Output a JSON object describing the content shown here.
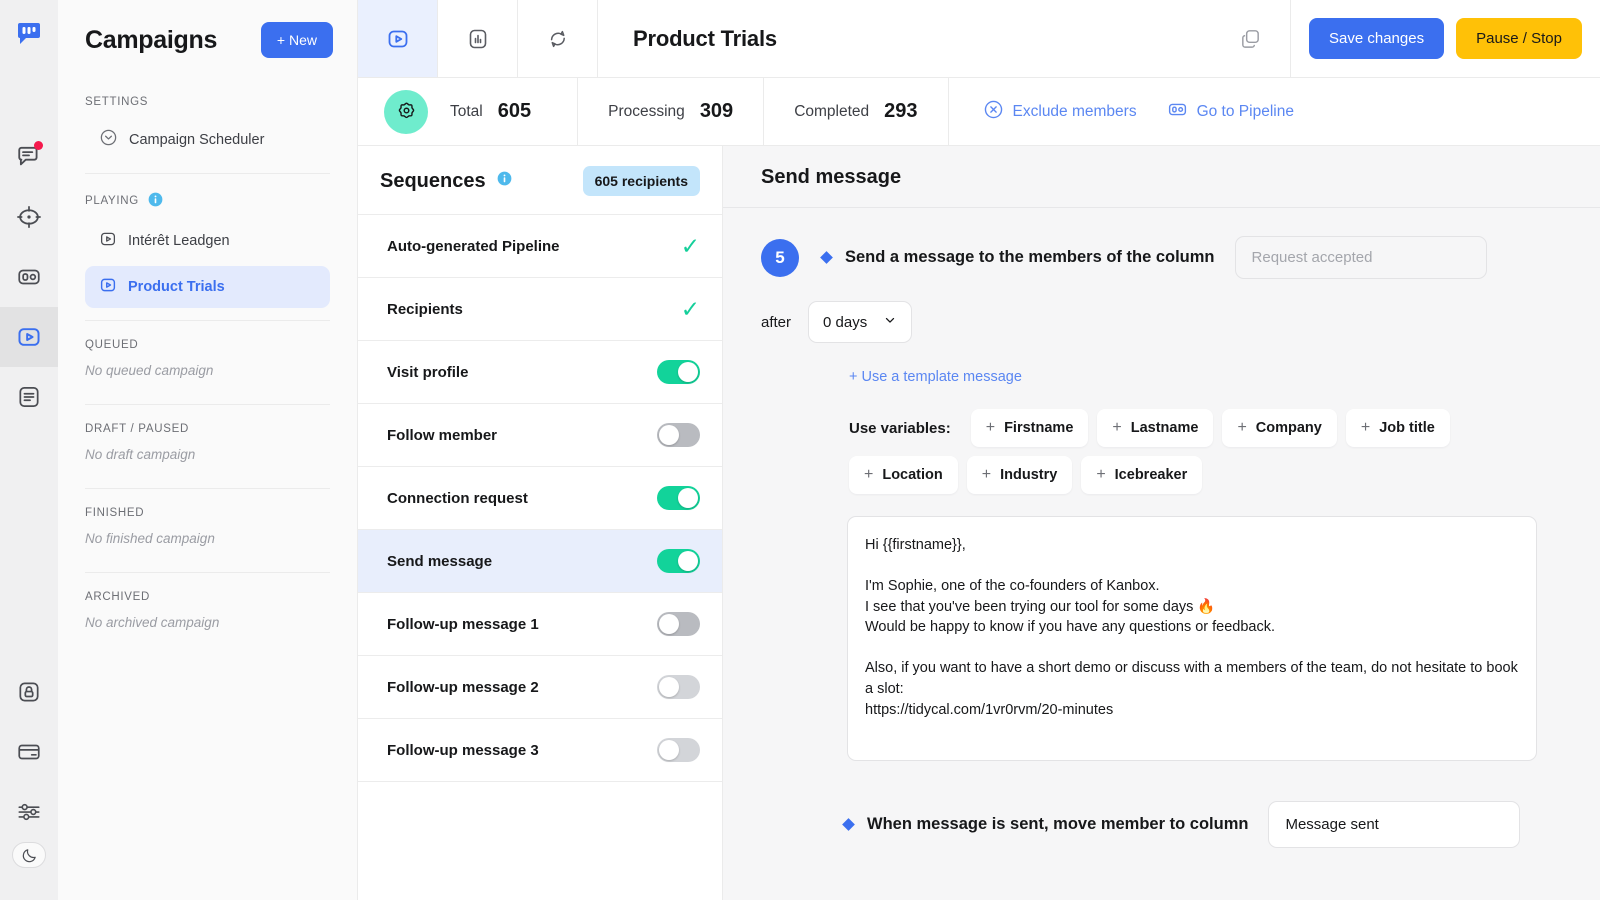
{
  "rail": {
    "logo": "kanbox-logo",
    "items": [
      {
        "name": "inbox-icon",
        "badge": true
      },
      {
        "name": "target-icon",
        "badge": false
      },
      {
        "name": "pipeline-icon",
        "badge": false
      },
      {
        "name": "campaigns-icon",
        "badge": false,
        "active": true
      },
      {
        "name": "templates-icon",
        "badge": false
      }
    ],
    "bottom_items": [
      {
        "name": "lock-icon"
      },
      {
        "name": "billing-card-icon"
      },
      {
        "name": "settings-sliders-icon"
      }
    ],
    "theme_toggle": "moon-icon"
  },
  "sidebar": {
    "title": "Campaigns",
    "new_button": "+ New",
    "settings_label": "SETTINGS",
    "scheduler_item": "Campaign Scheduler",
    "playing_label": "PLAYING",
    "playing_items": [
      {
        "label": "Intérêt Leadgen",
        "selected": false
      },
      {
        "label": "Product Trials",
        "selected": true
      }
    ],
    "queued_label": "QUEUED",
    "queued_empty": "No queued campaign",
    "draft_label": "DRAFT / PAUSED",
    "draft_empty": "No draft campaign",
    "finished_label": "FINISHED",
    "finished_empty": "No finished campaign",
    "archived_label": "ARCHIVED",
    "archived_empty": "No archived campaign"
  },
  "topbar": {
    "tabs": [
      {
        "name": "campaign-play-tab",
        "active": true
      },
      {
        "name": "analytics-bar-chart-tab",
        "active": false
      },
      {
        "name": "refresh-sync-tab",
        "active": false
      }
    ],
    "title": "Product Trials",
    "duplicate_icon": "duplicate-icon",
    "save_label": "Save changes",
    "pause_label": "Pause / Stop"
  },
  "stats": {
    "gear_icon": "gear-flower-icon",
    "items": [
      {
        "label": "Total",
        "value": "605"
      },
      {
        "label": "Processing",
        "value": "309"
      },
      {
        "label": "Completed",
        "value": "293"
      }
    ],
    "links": [
      {
        "label": "Exclude members",
        "icon": "circle-x-icon"
      },
      {
        "label": "Go to Pipeline",
        "icon": "pipeline-icon"
      }
    ]
  },
  "sequences": {
    "title": "Sequences",
    "info_icon": "info-icon",
    "badge": "605 recipients",
    "rows": [
      {
        "label": "Auto-generated Pipeline",
        "control": "check",
        "selected": false
      },
      {
        "label": "Recipients",
        "control": "check",
        "selected": false
      },
      {
        "label": "Visit profile",
        "control": "toggle-on",
        "selected": false
      },
      {
        "label": "Follow member",
        "control": "toggle-off",
        "selected": false
      },
      {
        "label": "Connection request",
        "control": "toggle-on",
        "selected": false
      },
      {
        "label": "Send message",
        "control": "toggle-on",
        "selected": true
      },
      {
        "label": "Follow-up message 1",
        "control": "toggle-off",
        "selected": false
      },
      {
        "label": "Follow-up message 2",
        "control": "toggle-off-light",
        "selected": false
      },
      {
        "label": "Follow-up message 3",
        "control": "toggle-off-light",
        "selected": false
      }
    ]
  },
  "detail": {
    "title": "Send message",
    "step_number": "5",
    "step_text": "Send a message to the members of the column",
    "column_placeholder": "Request accepted",
    "after_label": "after",
    "delay_value": "0 days",
    "template_link": "+ Use a template message",
    "variables_label": "Use variables:",
    "variables": [
      "Firstname",
      "Lastname",
      "Company",
      "Job title",
      "Location",
      "Industry",
      "Icebreaker"
    ],
    "message": "Hi {{firstname}},\n\nI'm Sophie, one of the co-founders of Kanbox.\nI see that you've been trying our tool for some days 🔥\nWould be happy to know if you have any questions or feedback.\n\nAlso, if you want to have a short demo or discuss with a members of the team, do not hesitate to book a slot:\nhttps://tidycal.com/1vr0rvm/20-minutes",
    "bottom_text": "When message is sent, move member to column",
    "bottom_value": "Message sent"
  },
  "colors": {
    "brand_blue": "#3b6fef",
    "accent_yellow": "#ffc107",
    "toggle_green": "#12d39a",
    "gear_teal": "#6feccd",
    "badge_blue": "#c3e5fb",
    "notification_red": "#f5194c"
  }
}
